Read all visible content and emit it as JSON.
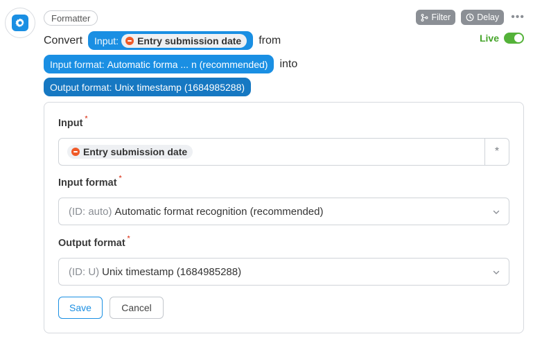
{
  "step": {
    "badge": "Formatter"
  },
  "actions": {
    "filter_label": "Filter",
    "delay_label": "Delay",
    "more": "•••"
  },
  "status": {
    "live_label": "Live",
    "live_on": true
  },
  "sentence": {
    "convert": "Convert",
    "from": "from",
    "into": "into",
    "input_key": "Input:",
    "input_token": "Entry submission date",
    "input_format_key": "Input format:",
    "input_format_value": "Automatic forma ... n (recommended)",
    "output_format_key": "Output format:",
    "output_format_value": "Unix timestamp (1684985288)"
  },
  "form": {
    "input_label": "Input",
    "input_token": "Entry submission date",
    "asterisk": "*",
    "input_format_label": "Input format",
    "input_format_id": "(ID: auto)",
    "input_format_value": "Automatic format recognition (recommended)",
    "output_format_label": "Output format",
    "output_format_id": "(ID: U)",
    "output_format_value": "Unix timestamp (1684985288)",
    "required_mark": "*",
    "save_label": "Save",
    "cancel_label": "Cancel"
  },
  "colors": {
    "accent": "#1a8fe3",
    "accent_dark": "#1678c2",
    "live": "#46a52b",
    "required": "#e0533d",
    "token_source": "#f05a28"
  },
  "icons": {
    "app": "gear-icon",
    "filter": "filter-branch-icon",
    "delay": "clock-icon",
    "token": "source-app-icon",
    "select": "chevron-down-icon"
  }
}
